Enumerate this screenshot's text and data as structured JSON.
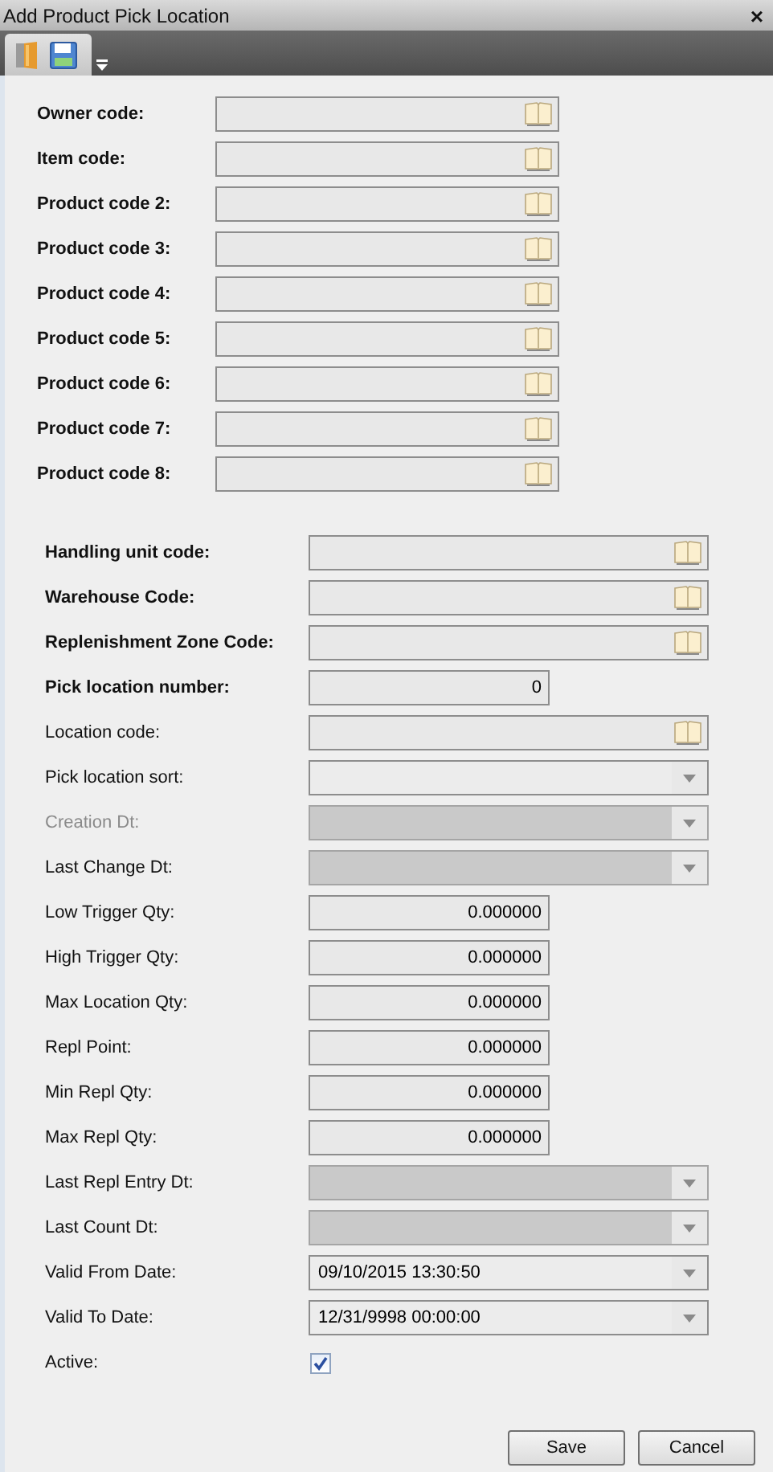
{
  "window": {
    "title": "Add Product Pick Location",
    "close": "×"
  },
  "groups": [
    {
      "fields": [
        {
          "label": "Owner code:",
          "bold": true,
          "dimmed": false,
          "kind": "lookup"
        },
        {
          "label": "Item code:",
          "bold": true,
          "dimmed": false,
          "kind": "lookup"
        },
        {
          "label": "Product code 2:",
          "bold": true,
          "dimmed": false,
          "kind": "lookup"
        },
        {
          "label": "Product code 3:",
          "bold": true,
          "dimmed": false,
          "kind": "lookup"
        },
        {
          "label": "Product code 4:",
          "bold": true,
          "dimmed": false,
          "kind": "lookup"
        },
        {
          "label": "Product code 5:",
          "bold": true,
          "dimmed": false,
          "kind": "lookup"
        },
        {
          "label": "Product code 6:",
          "bold": true,
          "dimmed": false,
          "kind": "lookup"
        },
        {
          "label": "Product code 7:",
          "bold": true,
          "dimmed": false,
          "kind": "lookup"
        },
        {
          "label": "Product code 8:",
          "bold": true,
          "dimmed": false,
          "kind": "lookup"
        }
      ]
    },
    {
      "fields": [
        {
          "label": "Handling unit code:",
          "bold": true,
          "dimmed": false,
          "kind": "lookup"
        },
        {
          "label": "Warehouse Code:",
          "bold": true,
          "dimmed": false,
          "kind": "lookup"
        },
        {
          "label": "Replenishment Zone Code:",
          "bold": true,
          "dimmed": false,
          "kind": "lookup"
        },
        {
          "label": "Pick location number:",
          "bold": true,
          "dimmed": false,
          "kind": "number",
          "value": "0"
        },
        {
          "label": "Location code:",
          "bold": false,
          "dimmed": false,
          "kind": "lookup"
        },
        {
          "label": "Pick location sort:",
          "bold": false,
          "dimmed": false,
          "kind": "dropdown",
          "disabled": false
        },
        {
          "label": "Creation Dt:",
          "bold": false,
          "dimmed": true,
          "kind": "dropdown",
          "disabled": true
        },
        {
          "label": "Last Change Dt:",
          "bold": false,
          "dimmed": false,
          "kind": "dropdown",
          "disabled": true
        },
        {
          "label": "Low Trigger Qty:",
          "bold": false,
          "dimmed": false,
          "kind": "number",
          "value": "0.000000"
        },
        {
          "label": "High Trigger Qty:",
          "bold": false,
          "dimmed": false,
          "kind": "number",
          "value": "0.000000"
        },
        {
          "label": "Max Location Qty:",
          "bold": false,
          "dimmed": false,
          "kind": "number",
          "value": "0.000000"
        },
        {
          "label": "Repl Point:",
          "bold": false,
          "dimmed": false,
          "kind": "number",
          "value": "0.000000"
        },
        {
          "label": "Min Repl Qty:",
          "bold": false,
          "dimmed": false,
          "kind": "number",
          "value": "0.000000"
        },
        {
          "label": "Max Repl Qty:",
          "bold": false,
          "dimmed": false,
          "kind": "number",
          "value": "0.000000"
        },
        {
          "label": "Last Repl Entry Dt:",
          "bold": false,
          "dimmed": false,
          "kind": "dropdown",
          "disabled": true
        },
        {
          "label": "Last Count Dt:",
          "bold": false,
          "dimmed": false,
          "kind": "dropdown",
          "disabled": true
        },
        {
          "label": "Valid From Date:",
          "bold": false,
          "dimmed": false,
          "kind": "dropdown",
          "disabled": false,
          "value": "09/10/2015 13:30:50"
        },
        {
          "label": "Valid To Date:",
          "bold": false,
          "dimmed": false,
          "kind": "dropdown",
          "disabled": false,
          "value": "12/31/9998 00:00:00"
        },
        {
          "label": "Active:",
          "bold": false,
          "dimmed": false,
          "kind": "checkbox",
          "checked": true
        }
      ]
    }
  ],
  "buttons": [
    "Save",
    "Cancel"
  ]
}
